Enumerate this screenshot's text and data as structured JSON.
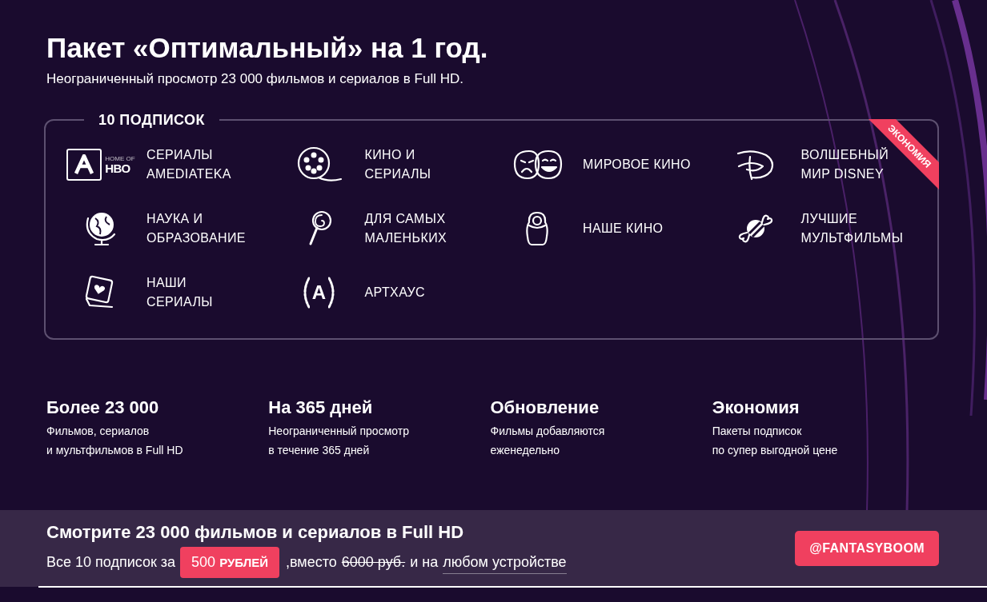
{
  "header": {
    "title": "Пакет «Оптимальный» на 1 год.",
    "subtitle": "Неограниченный просмотр 23 000 фильмов и сериалов в Full HD."
  },
  "package": {
    "legend": "10 ПОДПИСОК",
    "ribbon": "ЭКОНОМИЯ",
    "items": [
      {
        "kind": "amediateka",
        "lines": [
          "СЕРИАЛЫ",
          "AMEDIATEKA"
        ],
        "logo_text": [
          "HOME OF",
          "HBO"
        ]
      },
      {
        "kind": "film-reel",
        "lines": [
          "КИНО И",
          "СЕРИАЛЫ"
        ]
      },
      {
        "kind": "masks",
        "lines": [
          "МИРОВОЕ КИНО"
        ]
      },
      {
        "kind": "disney",
        "lines": [
          "ВОЛШЕБНЫЙ",
          "МИР DISNEY"
        ]
      },
      {
        "kind": "globe",
        "lines": [
          "НАУКА И",
          "ОБРАЗОВАНИЕ"
        ]
      },
      {
        "kind": "lollipop",
        "lines": [
          "ДЛЯ САМЫХ",
          "МАЛЕНЬКИХ"
        ]
      },
      {
        "kind": "doll",
        "lines": [
          "НАШЕ КИНО"
        ]
      },
      {
        "kind": "candy",
        "lines": [
          "ЛУЧШИЕ",
          "МУЛЬТФИЛЬМЫ"
        ]
      },
      {
        "kind": "photo-heart",
        "lines": [
          "НАШИ",
          "СЕРИАЛЫ"
        ]
      },
      {
        "kind": "arthouse",
        "lines": [
          "АРТХАУС"
        ],
        "logo_text": [
          "A"
        ]
      }
    ]
  },
  "features": [
    {
      "title": "Более 23 000",
      "lines": [
        "Фильмов, сериалов",
        "и мультфильмов в Full HD"
      ]
    },
    {
      "title": "На 365 дней",
      "lines": [
        "Неограниченный просмотр",
        "в течение 365 дней"
      ]
    },
    {
      "title": "Обновление",
      "lines": [
        "Фильмы добавляются",
        "еженедельно"
      ]
    },
    {
      "title": "Экономия",
      "lines": [
        "Пакеты подписок",
        "по супер выгодной цене"
      ]
    }
  ],
  "offer": {
    "title": "Смотрите 23 000 фильмов и сериалов в Full HD",
    "prefix": "Все 10 подписок за",
    "price_number": "500",
    "price_unit": "РУБЛЕЙ",
    "instead": ",вместо",
    "old_price": "6000 руб.",
    "connector": "и на",
    "link": "любом устройстве",
    "button": "@FANTASYBOOM"
  }
}
